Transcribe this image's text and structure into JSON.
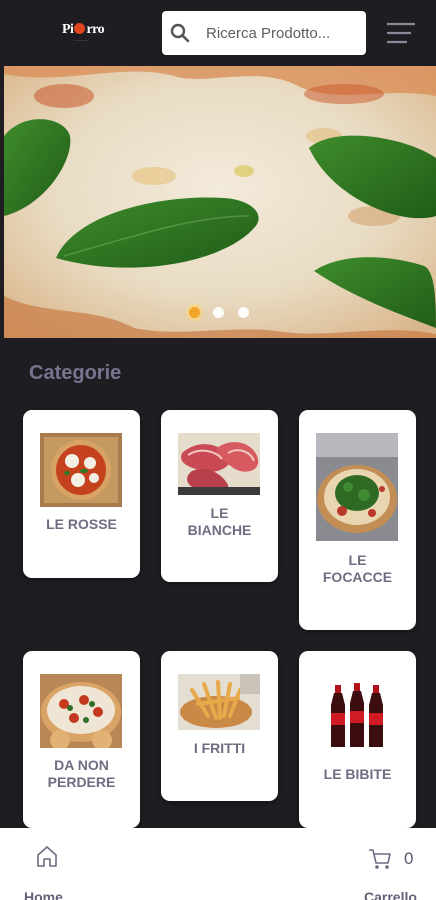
{
  "header": {
    "logo_text_a": "Pi",
    "logo_text_b": "rro",
    "search_placeholder": "Ricerca Prodotto...",
    "search_icon": "search-icon",
    "menu_icon": "hamburger-menu-icon"
  },
  "carousel": {
    "slide_count": 3,
    "active_slide": 1,
    "image": "margherita-pizza-closeup"
  },
  "categories": {
    "title": "Categorie",
    "items": [
      {
        "label": "LE ROSSE",
        "image": "red-pizza-photo"
      },
      {
        "label": "LE\nBIANCHE",
        "image": "prosciutto-white-pizza-photo"
      },
      {
        "label": "LE\nFOCACCE",
        "image": "focaccia-rucola-photo"
      },
      {
        "label": "DA NON\nPERDERE",
        "image": "special-pizza-photo"
      },
      {
        "label": "I FRITTI",
        "image": "fries-photo"
      },
      {
        "label": "LE BIBITE",
        "image": "cola-bottles-photo"
      }
    ]
  },
  "bottom_nav": {
    "home_label": "Home",
    "cart_label": "Carrello",
    "cart_count": "0",
    "home_icon": "home-icon",
    "cart_icon": "cart-icon"
  },
  "colors": {
    "background": "#1f1d22",
    "card": "#ffffff",
    "label": "#6f6d82",
    "accent_dot": "#f1a21f"
  }
}
